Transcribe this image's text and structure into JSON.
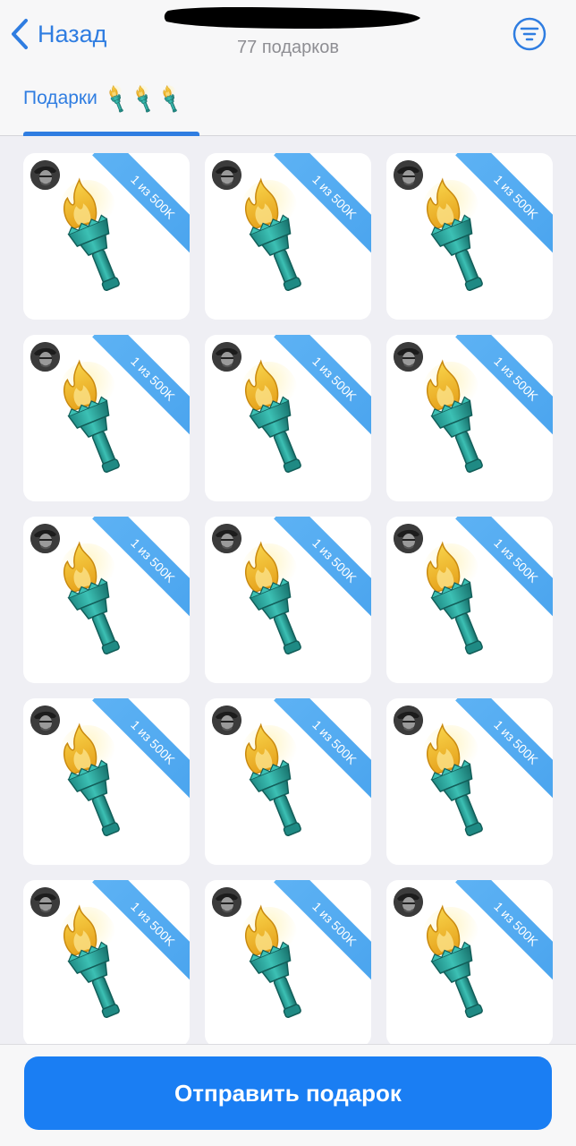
{
  "header": {
    "back_label": "Назад",
    "subtitle": "77 подарков",
    "filter_icon": "filter-icon",
    "accent": "#2f7de1"
  },
  "tabs": [
    {
      "label": "Подарки",
      "emoji_count": 3,
      "active": true
    }
  ],
  "gifts": {
    "ribbon_label": "1 из 500K",
    "ribbon_color": "#4aa4ee",
    "icon": "torch",
    "items": [
      {
        "ribbon": "1 из 500K"
      },
      {
        "ribbon": "1 из 500K"
      },
      {
        "ribbon": "1 из 500K"
      },
      {
        "ribbon": "1 из 500K"
      },
      {
        "ribbon": "1 из 500K"
      },
      {
        "ribbon": "1 из 500K"
      },
      {
        "ribbon": "1 из 500K"
      },
      {
        "ribbon": "1 из 500K"
      },
      {
        "ribbon": "1 из 500K"
      },
      {
        "ribbon": "1 из 500K"
      },
      {
        "ribbon": "1 из 500K"
      },
      {
        "ribbon": "1 из 500K"
      },
      {
        "ribbon": "1 из 500K"
      },
      {
        "ribbon": "1 из 500K"
      },
      {
        "ribbon": "1 из 500K"
      }
    ]
  },
  "footer": {
    "send_label": "Отправить подарок",
    "button_color": "#1a7ef3"
  }
}
